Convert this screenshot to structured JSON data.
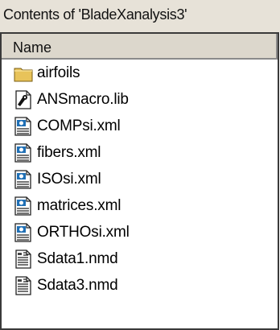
{
  "window": {
    "title": "Contents of 'BladeXanalysis3'"
  },
  "columns": {
    "name": "Name"
  },
  "files": [
    {
      "name": "airfoils",
      "icon": "folder-icon"
    },
    {
      "name": "ANSmacro.lib",
      "icon": "library-file-icon"
    },
    {
      "name": "COMPsi.xml",
      "icon": "xml-file-icon"
    },
    {
      "name": "fibers.xml",
      "icon": "xml-file-icon"
    },
    {
      "name": "ISOsi.xml",
      "icon": "xml-file-icon"
    },
    {
      "name": "matrices.xml",
      "icon": "xml-file-icon"
    },
    {
      "name": "ORTHOsi.xml",
      "icon": "xml-file-icon"
    },
    {
      "name": "Sdata1.nmd",
      "icon": "nmd-file-icon"
    },
    {
      "name": "Sdata3.nmd",
      "icon": "nmd-file-icon"
    }
  ],
  "colors": {
    "folder": "#e8c35a",
    "xml_accent": "#1f6fb5"
  }
}
